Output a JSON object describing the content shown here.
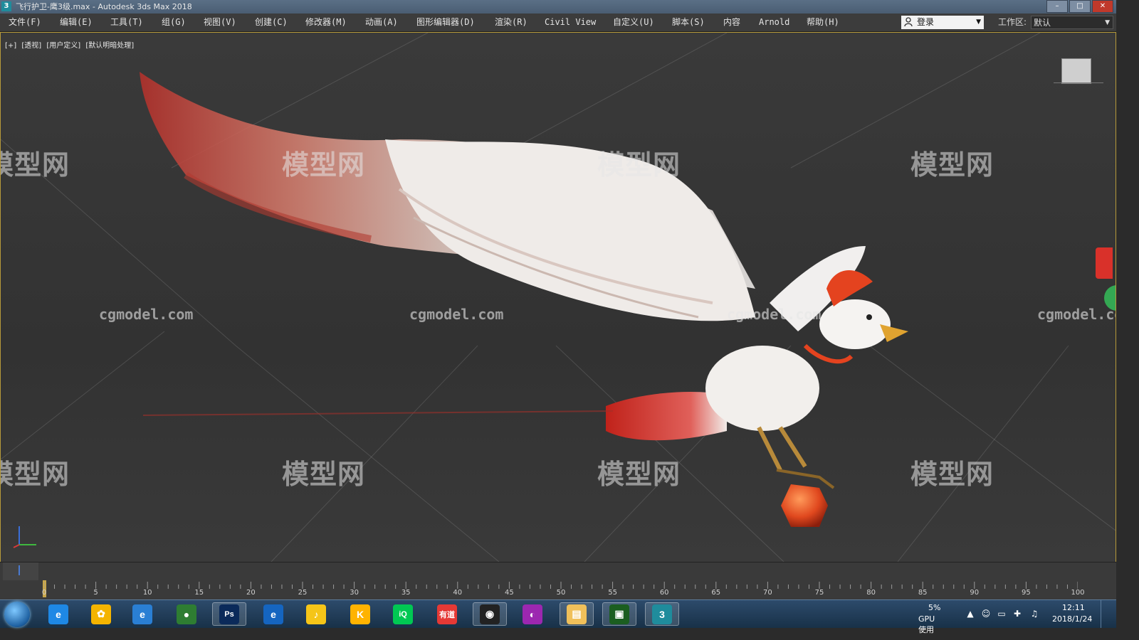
{
  "window": {
    "title": "飞行护卫-鹰3级.max - Autodesk 3ds Max 2018",
    "app_icon": "3"
  },
  "menu": [
    "文件(F)",
    "编辑(E)",
    "工具(T)",
    "组(G)",
    "视图(V)",
    "创建(C)",
    "修改器(M)",
    "动画(A)",
    "图形编辑器(D)",
    "渲染(R)",
    "Civil View",
    "自定义(U)",
    "脚本(S)",
    "内容",
    "Arnold",
    "帮助(H)"
  ],
  "login": {
    "label": "登录"
  },
  "workspace": {
    "label": "工作区:",
    "value": "默认"
  },
  "viewport": {
    "labels": [
      "[+]",
      "[透视]",
      "[用户定义]",
      "[默认明暗处理]"
    ],
    "watermark_cn": "模型网",
    "watermark_en": "cgmodel.com"
  },
  "timeline": {
    "ticks": [
      "0",
      "5",
      "10",
      "15",
      "20",
      "25",
      "30",
      "35",
      "40",
      "45",
      "50",
      "55",
      "60",
      "65",
      "70",
      "75",
      "80",
      "85",
      "90",
      "95",
      "100"
    ]
  },
  "taskbar": {
    "apps": [
      {
        "icon": "ie-icon",
        "glyph": "e",
        "color": "#1e88e5"
      },
      {
        "icon": "colorful-app-icon",
        "glyph": "✿",
        "color": "#f4b400"
      },
      {
        "icon": "browser-icon",
        "glyph": "e",
        "color": "#2a7fd4"
      },
      {
        "icon": "record-icon",
        "glyph": "●",
        "color": "#2e7d32"
      },
      {
        "icon": "photoshop-icon",
        "glyph": "Ps",
        "color": "#0b2a5a"
      },
      {
        "icon": "ie2-icon",
        "glyph": "e",
        "color": "#1565c0"
      },
      {
        "icon": "qq-music-icon",
        "glyph": "♪",
        "color": "#f5c518"
      },
      {
        "icon": "kugou-icon",
        "glyph": "K",
        "color": "#ffb300"
      },
      {
        "icon": "iqiyi-icon",
        "glyph": "iQ",
        "color": "#00c853"
      },
      {
        "icon": "youdao-icon",
        "glyph": "有道",
        "color": "#e53935"
      },
      {
        "icon": "camera-icon",
        "glyph": "◉",
        "color": "#222"
      },
      {
        "icon": "color-wheel-icon",
        "glyph": "◐",
        "color": "#9c27b0"
      },
      {
        "icon": "explorer-icon",
        "glyph": "▤",
        "color": "#f0c05a"
      },
      {
        "icon": "image-viewer-icon",
        "glyph": "▣",
        "color": "#1b5e20"
      },
      {
        "icon": "3dsmax-icon",
        "glyph": "3",
        "color": "#1f8c9c"
      }
    ],
    "gpu_pct": "5%",
    "gpu_label": "GPU使用",
    "time": "12:11",
    "date": "2018/1/24"
  }
}
